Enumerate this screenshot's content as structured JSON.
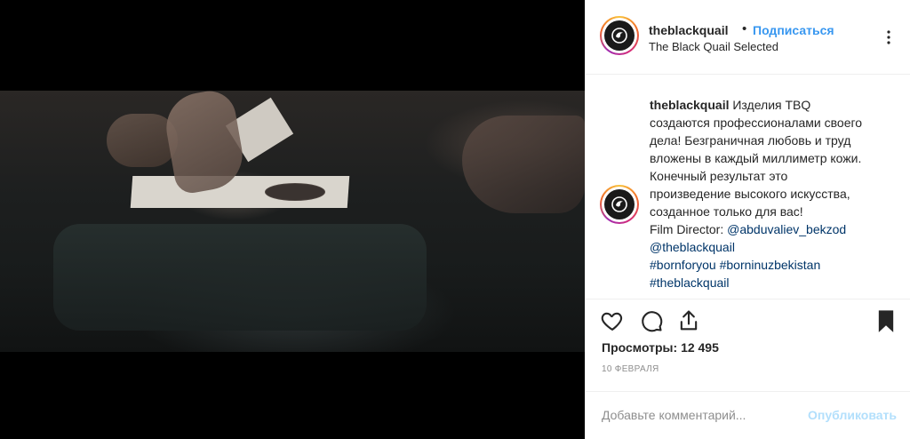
{
  "post": {
    "username": "theblackquail",
    "follow_label": "Подписаться",
    "separator": "•",
    "location": "The Black Quail Selected",
    "more_icon": "more-options-icon"
  },
  "caption": {
    "username": "theblackquail",
    "lines": [
      "Изделия TBQ",
      "создаются профессионалами своего",
      "дела! Безграничная любовь и труд",
      "вложены в каждый миллиметр кожи.",
      "Конечный результат это",
      "произведение высокого искусства,",
      "созданное только для вас!"
    ],
    "director_prefix": "Film Director: ",
    "director_handle": "@abduvaliev_bekzod",
    "mention": "@theblackquail",
    "hashtags_line1": "#bornforyou #borninuzbekistan",
    "hashtags_line2": "#theblackquail"
  },
  "actions": {
    "icons": [
      "heart-icon",
      "comment-icon",
      "share-icon",
      "bookmark-icon"
    ]
  },
  "stats": {
    "views_label": "Просмотры:",
    "views_value": "12 495",
    "date": "10 ФЕВРАЛЯ"
  },
  "comment": {
    "placeholder": "Добавьте комментарий...",
    "publish_label": "Опубликовать"
  },
  "colors": {
    "accent": "#3897f0",
    "link": "#003569",
    "muted": "#8e8e8e",
    "publish_disabled": "#b2dffc"
  }
}
